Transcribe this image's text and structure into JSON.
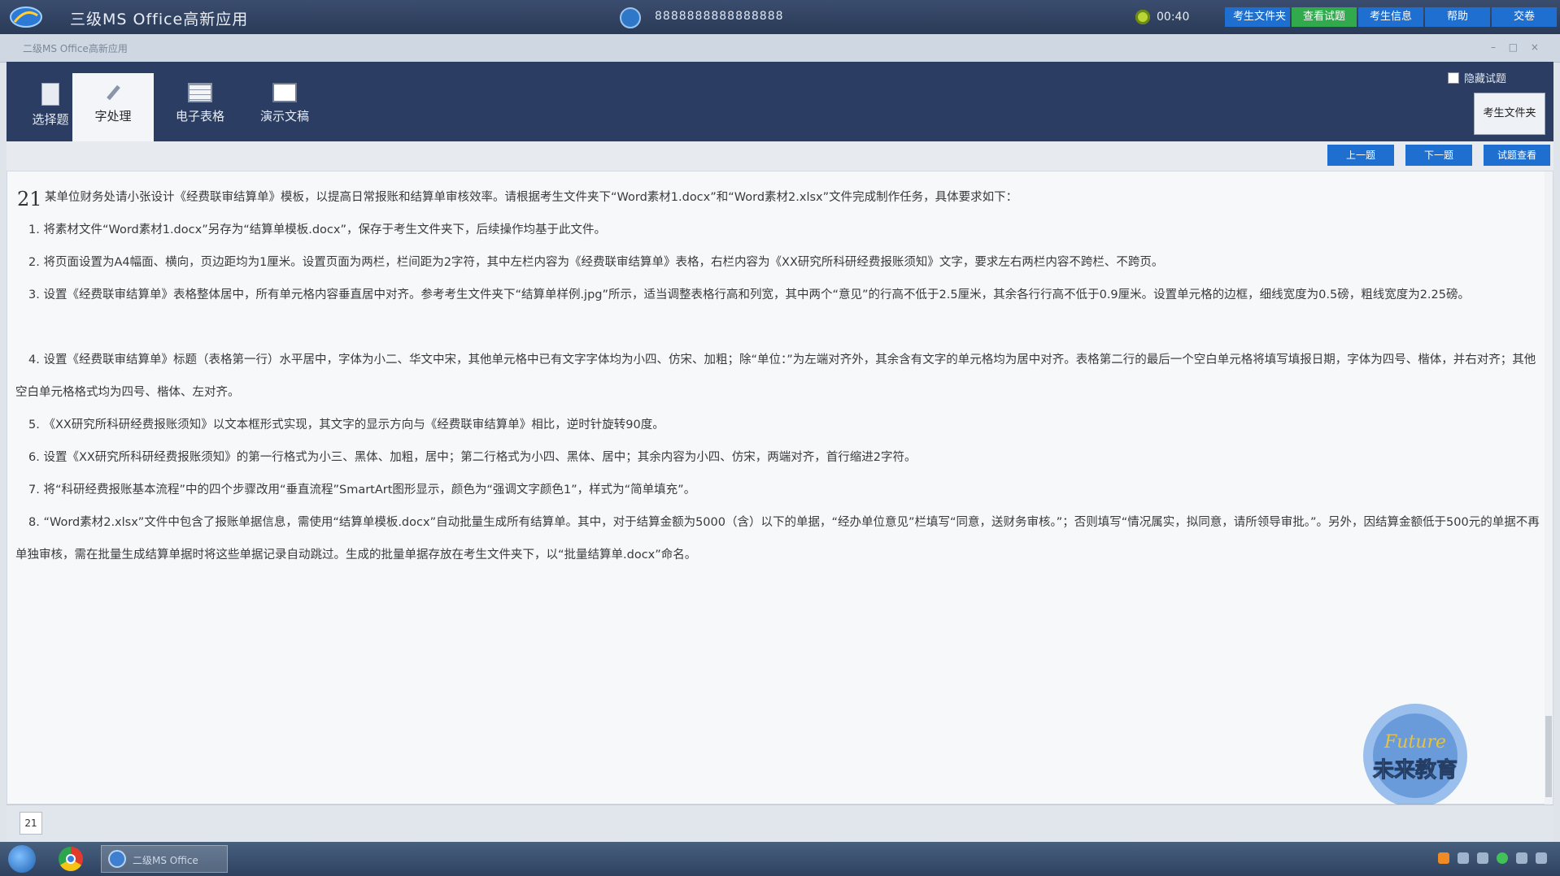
{
  "titlebar": {
    "app_title": "三级MS Office高新应用",
    "exam_id": "8888888888888888",
    "timer": "00:40",
    "buttons": [
      "考生文件夹",
      "查看试题",
      "考生信息",
      "帮助",
      "交卷"
    ]
  },
  "subbar": {
    "text": "二级MS Office高新应用",
    "controls": "– □ ×"
  },
  "ribbon": {
    "tabs": [
      {
        "label": "选择题",
        "icon": "document-icon",
        "active": false
      },
      {
        "label": "字处理",
        "icon": "pen-icon",
        "active": true
      },
      {
        "label": "电子表格",
        "icon": "spreadsheet-icon",
        "active": false
      },
      {
        "label": "演示文稿",
        "icon": "presentation-icon",
        "active": false
      }
    ],
    "checkbox_label": "隐藏试题",
    "folder_button": "考生文件夹"
  },
  "actions": [
    "上一题",
    "下一题",
    "试题查看"
  ],
  "question": {
    "number": "21",
    "intro": "某单位财务处请小张设计《经费联审结算单》模板，以提高日常报账和结算单审核效率。请根据考生文件夹下“Word素材1.docx”和“Word素材2.xlsx”文件完成制作任务，具体要求如下：",
    "items": [
      "1. 将素材文件“Word素材1.docx”另存为“结算单模板.docx”，保存于考生文件夹下，后续操作均基于此文件。",
      "2. 将页面设置为A4幅面、横向，页边距均为1厘米。设置页面为两栏，栏间距为2字符，其中左栏内容为《经费联审结算单》表格，右栏内容为《XX研究所科研经费报账须知》文字，要求左右两栏内容不跨栏、不跨页。",
      "3. 设置《经费联审结算单》表格整体居中，所有单元格内容垂直居中对齐。参考考生文件夹下“结算单样例.jpg”所示，适当调整表格行高和列宽，其中两个“意见”的行高不低于2.5厘米，其余各行行高不低于0.9厘米。设置单元格的边框，细线宽度为0.5磅，粗线宽度为2.25磅。",
      "4. 设置《经费联审结算单》标题（表格第一行）水平居中，字体为小二、华文中宋，其他单元格中已有文字字体均为小四、仿宋、加粗；除“单位：”为左端对齐外，其余含有文字的单元格均为居中对齐。表格第二行的最后一个空白单元格将填写填报日期，字体为四号、楷体，并右对齐；其他空白单元格格式均为四号、楷体、左对齐。",
      "5. 《XX研究所科研经费报账须知》以文本框形式实现，其文字的显示方向与《经费联审结算单》相比，逆时针旋转90度。",
      "6. 设置《XX研究所科研经费报账须知》的第一行格式为小三、黑体、加粗，居中；第二行格式为小四、黑体、居中；其余内容为小四、仿宋，两端对齐，首行缩进2字符。",
      "7. 将“科研经费报账基本流程”中的四个步骤改用“垂直流程”SmartArt图形显示，颜色为“强调文字颜色1”，样式为“简单填充”。",
      "8. “Word素材2.xlsx”文件中包含了报账单据信息，需使用“结算单模板.docx”自动批量生成所有结算单。其中，对于结算金额为5000（含）以下的单据，“经办单位意见”栏填写“同意，送财务审核。”；否则填写“情况属实，拟同意，请所领导审批。”。另外，因结算金额低于500元的单据不再单独审核，需在批量生成结算单据时将这些单据记录自动跳过。生成的批量单据存放在考生文件夹下，以“批量结算单.docx”命名。"
    ]
  },
  "footer": {
    "question_nav": "21"
  },
  "watermark": {
    "line1": "Future",
    "line2": "未来教育"
  },
  "taskbar": {
    "app_label": "二级MS Office"
  }
}
